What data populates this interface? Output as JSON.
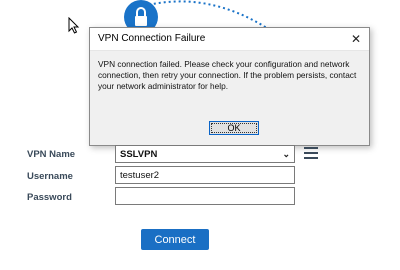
{
  "dialog": {
    "title": "VPN Connection Failure",
    "message": "VPN connection failed. Please check your configuration and network connection, then retry your connection. If the problem persists, contact your network administrator for help.",
    "ok_label": "OK"
  },
  "form": {
    "vpn_name_label": "VPN Name",
    "vpn_name_value": "SSLVPN",
    "username_label": "Username",
    "username_value": "testuser2",
    "password_label": "Password",
    "password_value": ""
  },
  "connect_label": "Connect",
  "colors": {
    "accent": "#1a6fc4",
    "label": "#3a4a5a"
  },
  "icons": [
    "lock-icon",
    "cursor-icon",
    "close-icon",
    "chevron-down-icon",
    "menu-icon"
  ]
}
